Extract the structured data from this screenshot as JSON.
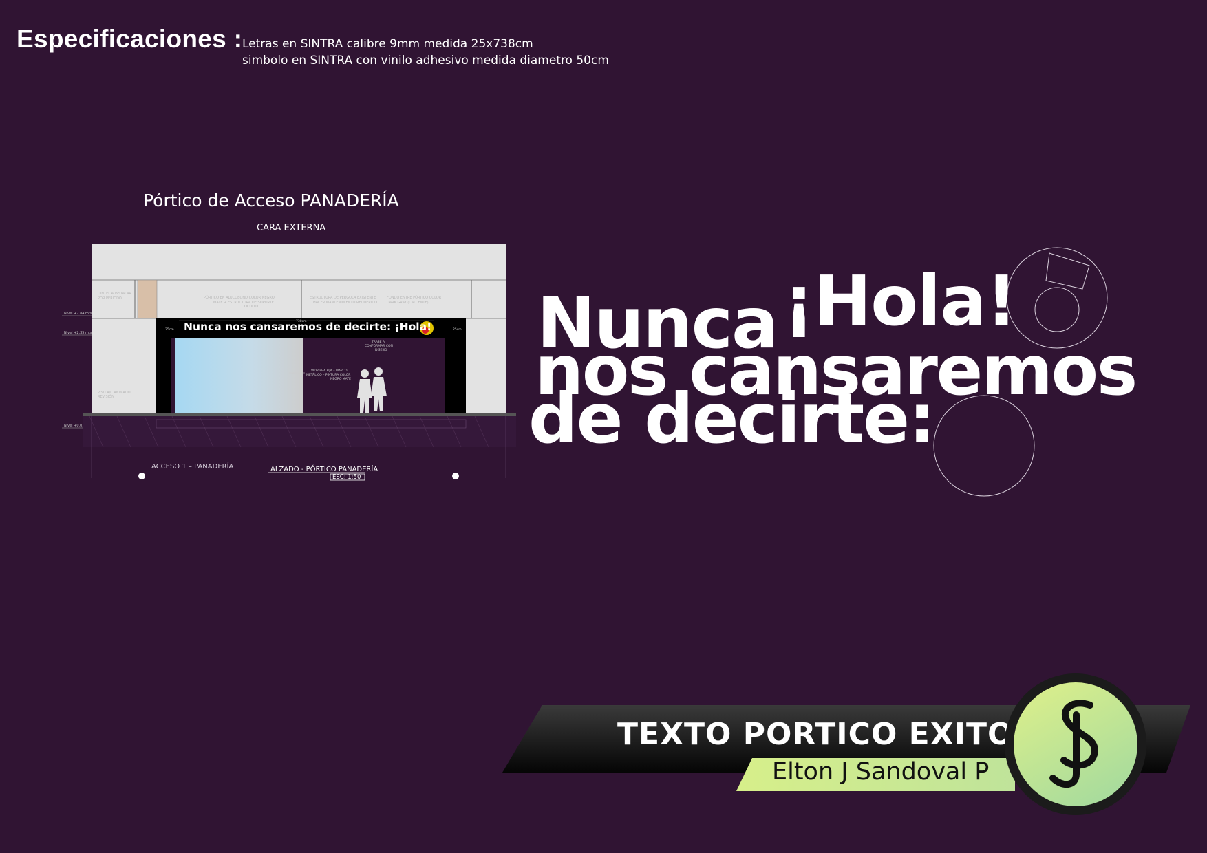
{
  "specs": {
    "title": "Especificaciones :",
    "lines": [
      "Letras en SINTRA calibre 9mm medida 25x738cm",
      "simbolo en SINTRA con vinilo adhesivo medida diametro 50cm"
    ]
  },
  "portico": {
    "title": "Pórtico de Acceso PANADERÍA",
    "face_label": "CARA EXTERNA",
    "sign_text": "Nunca nos cansaremos de decirte: ¡Hola!",
    "access_label": "ACCESO 1 – PANADERÍA",
    "drawing_title": "ALZADO - PÓRTICO PANADERÍA",
    "scale": "ESC: 1:50"
  },
  "headline": {
    "word1": "Nunca",
    "word2": "¡Hola!",
    "line2": "nos cansaremos",
    "line3": "de decirte:"
  },
  "banner": {
    "title": "TEXTO PORTICO EXITO",
    "author": "Elton J Sandoval P"
  },
  "colors": {
    "background": "#301433",
    "accent_green": "#cfe58a",
    "banner_dark": "#111111"
  }
}
